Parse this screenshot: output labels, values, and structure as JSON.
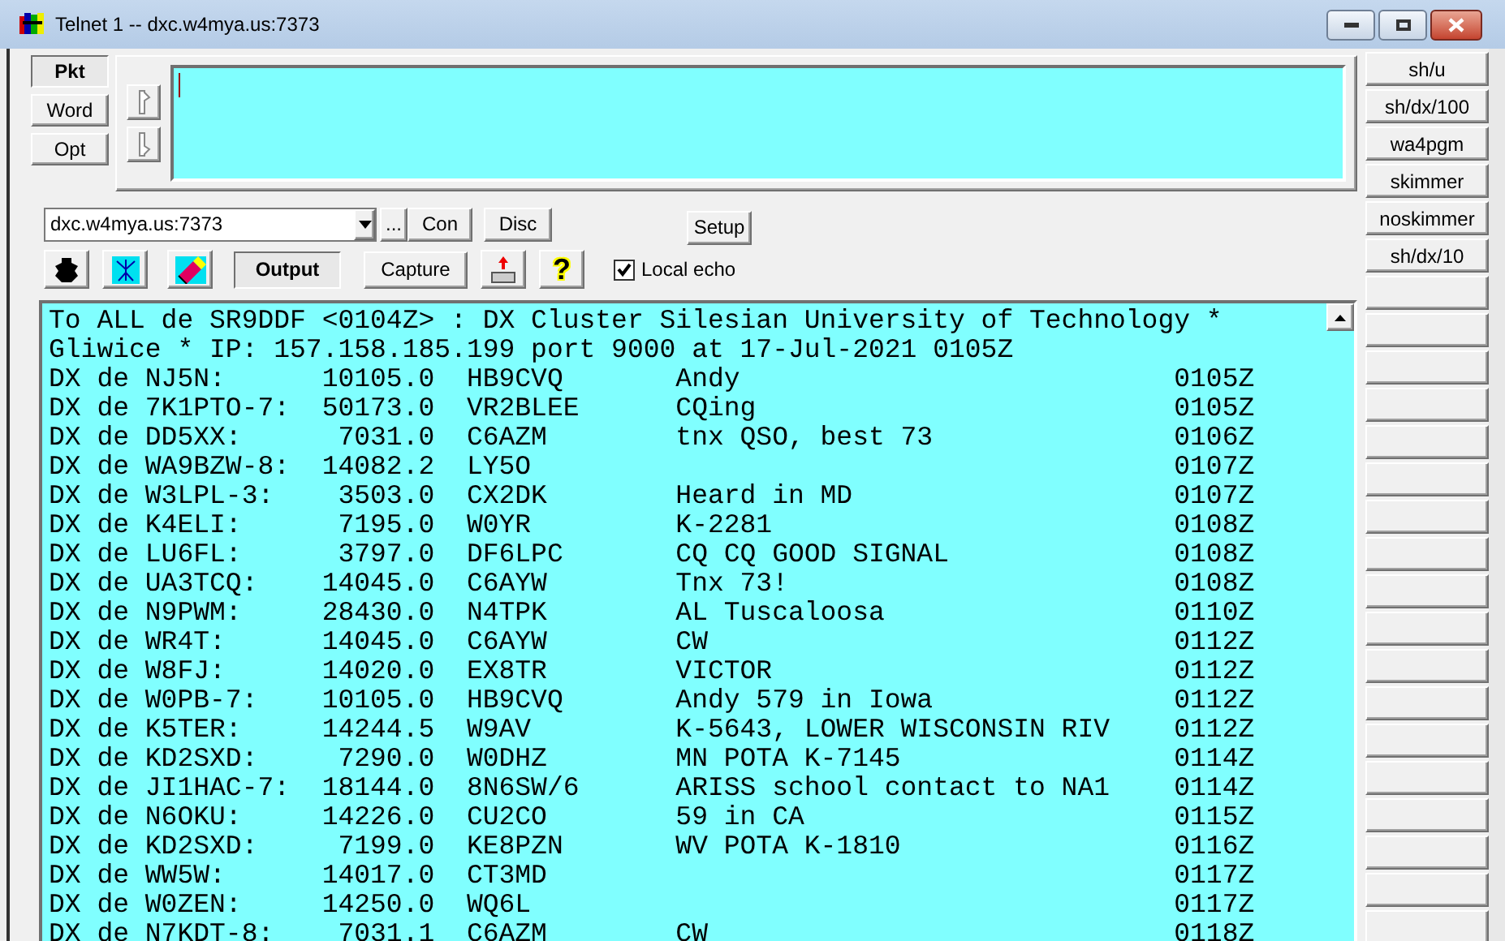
{
  "window": {
    "title": "Telnet 1 -- dxc.w4mya.us:7373"
  },
  "mode_buttons": [
    {
      "label": "Pkt",
      "selected": true
    },
    {
      "label": "Word",
      "selected": false
    },
    {
      "label": "Opt",
      "selected": false
    }
  ],
  "host_field": {
    "value": "dxc.w4mya.us:7373"
  },
  "browse_button": {
    "label": "..."
  },
  "connect_buttons": [
    {
      "label": "Con"
    },
    {
      "label": "Disc"
    }
  ],
  "setup_button": {
    "label": "Setup"
  },
  "view_buttons": [
    {
      "label": "Output",
      "selected": true
    },
    {
      "label": "Capture",
      "selected": false
    }
  ],
  "help_button": {
    "label": "?"
  },
  "local_echo": {
    "label": "Local echo",
    "checked": true
  },
  "macros": [
    "sh/u",
    "sh/dx/100",
    "wa4pgm",
    "skimmer",
    "noskimmer",
    "sh/dx/10"
  ],
  "terminal": {
    "header_lines": [
      "To ALL de SR9DDF <0104Z> : DX Cluster Silesian University of Technology *",
      "Gliwice * IP: 157.158.185.199 port 9000 at 17-Jul-2021 0105Z"
    ],
    "spots": [
      {
        "spotter": "DX de NJ5N:",
        "freq": "10105.0",
        "dx": "HB9CVQ",
        "comment": "Andy",
        "time": "0105Z"
      },
      {
        "spotter": "DX de 7K1PTO-7:",
        "freq": "50173.0",
        "dx": "VR2BLEE",
        "comment": "CQing",
        "time": "0105Z"
      },
      {
        "spotter": "DX de DD5XX:",
        "freq": "7031.0",
        "dx": "C6AZM",
        "comment": "tnx QSO, best 73",
        "time": "0106Z"
      },
      {
        "spotter": "DX de WA9BZW-8:",
        "freq": "14082.2",
        "dx": "LY5O",
        "time": "0107Z"
      },
      {
        "spotter": "DX de W3LPL-3:",
        "freq": "3503.0",
        "dx": "CX2DK",
        "comment": "Heard in MD",
        "time": "0107Z"
      },
      {
        "spotter": "DX de K4ELI:",
        "freq": "7195.0",
        "dx": "W0YR",
        "comment": "K-2281",
        "time": "0108Z"
      },
      {
        "spotter": "DX de LU6FL:",
        "freq": "3797.0",
        "dx": "DF6LPC",
        "comment": "CQ CQ GOOD SIGNAL",
        "time": "0108Z"
      },
      {
        "spotter": "DX de UA3TCQ:",
        "freq": "14045.0",
        "dx": "C6AYW",
        "comment": "Tnx 73!",
        "time": "0108Z"
      },
      {
        "spotter": "DX de N9PWM:",
        "freq": "28430.0",
        "dx": "N4TPK",
        "comment": "AL Tuscaloosa",
        "time": "0110Z"
      },
      {
        "spotter": "DX de WR4T:",
        "freq": "14045.0",
        "dx": "C6AYW",
        "comment": "CW",
        "time": "0112Z"
      },
      {
        "spotter": "DX de W8FJ:",
        "freq": "14020.0",
        "dx": "EX8TR",
        "comment": "VICTOR",
        "time": "0112Z"
      },
      {
        "spotter": "DX de W0PB-7:",
        "freq": "10105.0",
        "dx": "HB9CVQ",
        "comment": "Andy 579 in Iowa",
        "time": "0112Z"
      },
      {
        "spotter": "DX de K5TER:",
        "freq": "14244.5",
        "dx": "W9AV",
        "comment": "K-5643, LOWER WISCONSIN RIV",
        "time": "0112Z"
      },
      {
        "spotter": "DX de KD2SXD:",
        "freq": "7290.0",
        "dx": "W0DHZ",
        "comment": "MN POTA K-7145",
        "time": "0114Z"
      },
      {
        "spotter": "DX de JI1HAC-7:",
        "freq": "18144.0",
        "dx": "8N6SW/6",
        "comment": "ARISS school contact to NA1",
        "time": "0114Z"
      },
      {
        "spotter": "DX de N6OKU:",
        "freq": "14226.0",
        "dx": "CU2CO",
        "comment": "59 in CA",
        "time": "0115Z"
      },
      {
        "spotter": "DX de KD2SXD:",
        "freq": "7199.0",
        "dx": "KE8PZN",
        "comment": "WV POTA K-1810",
        "time": "0116Z"
      },
      {
        "spotter": "DX de WW5W:",
        "freq": "14017.0",
        "dx": "CT3MD",
        "time": "0117Z"
      },
      {
        "spotter": "DX de W0ZEN:",
        "freq": "14250.0",
        "dx": "WQ6L",
        "time": "0117Z"
      },
      {
        "spotter": "DX de N7KDT-8:",
        "freq": "7031.1",
        "dx": "C6AZM",
        "comment": "CW",
        "time": "0118Z"
      }
    ]
  }
}
